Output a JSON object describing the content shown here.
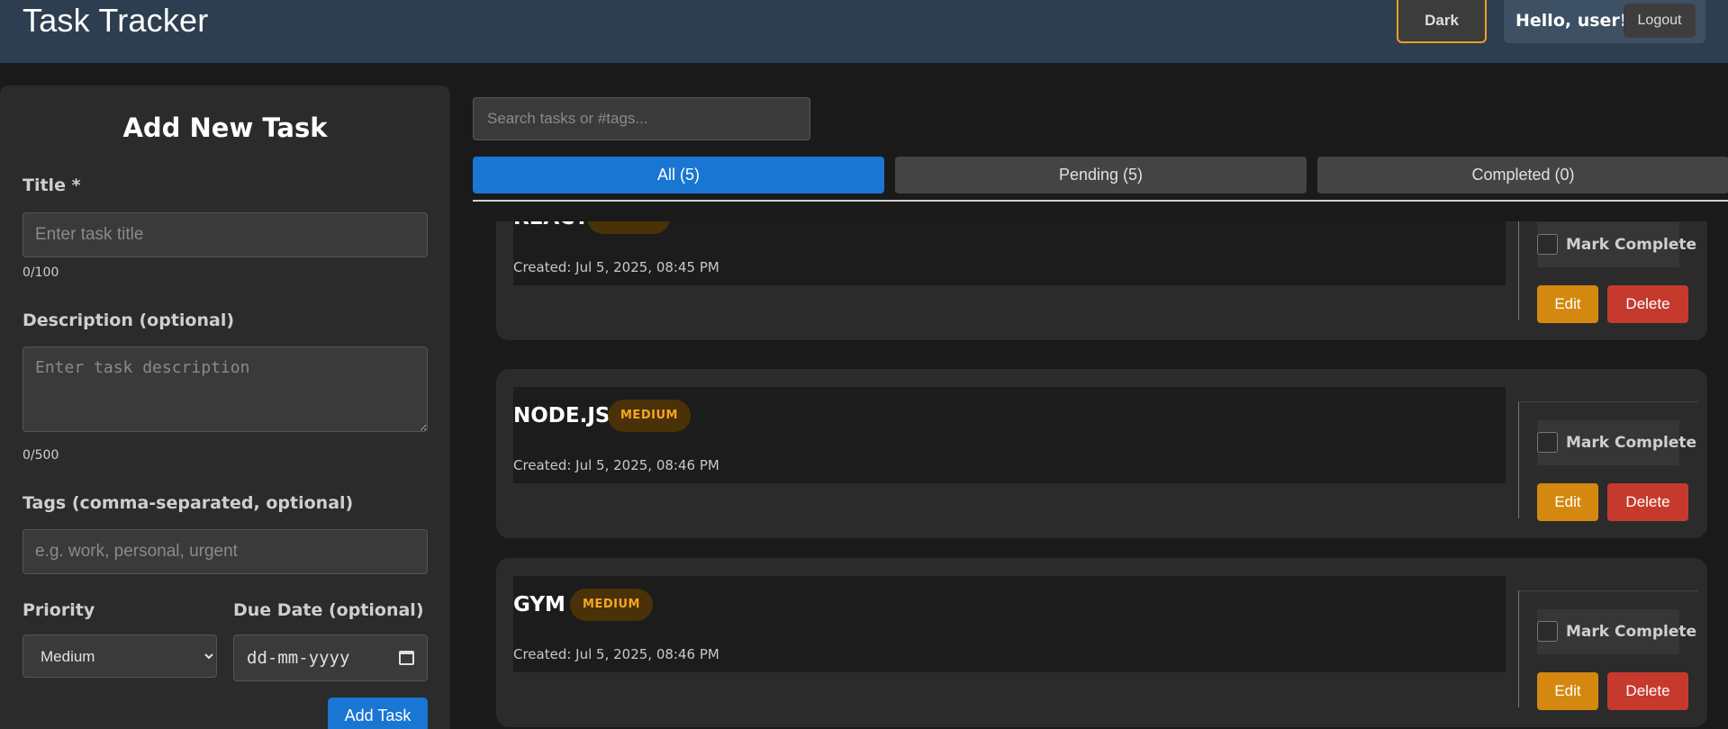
{
  "header": {
    "title": "Task Tracker",
    "theme_button": "Dark",
    "greeting": "Hello, user!",
    "logout": "Logout"
  },
  "form": {
    "heading": "Add New Task",
    "title_label": "Title *",
    "title_placeholder": "Enter task title",
    "title_value": "",
    "title_counter": "0/100",
    "description_label": "Description (optional)",
    "description_placeholder": "Enter task description",
    "description_counter": "0/500",
    "tags_label": "Tags (comma-separated, optional)",
    "tags_placeholder": "e.g. work, personal, urgent",
    "priority_label": "Priority",
    "priority_selected": "Medium",
    "due_label": "Due Date (optional)",
    "due_placeholder": "dd-mm-yyyy",
    "submit": "Add Task"
  },
  "search": {
    "placeholder": "Search tasks or #tags..."
  },
  "tabs": [
    {
      "label": "All (5)",
      "active": true
    },
    {
      "label": "Pending (5)",
      "active": false
    },
    {
      "label": "Completed (0)",
      "active": false
    }
  ],
  "tasks": [
    {
      "title": "REACT",
      "priority": "MEDIUM",
      "created": "Created: Jul 5, 2025, 08:45 PM",
      "mark_label": "Mark Complete",
      "edit": "Edit",
      "delete": "Delete"
    },
    {
      "title": "NODE.JS",
      "priority": "MEDIUM",
      "created": "Created: Jul 5, 2025, 08:46 PM",
      "mark_label": "Mark Complete",
      "edit": "Edit",
      "delete": "Delete"
    },
    {
      "title": "GYM",
      "priority": "MEDIUM",
      "created": "Created: Jul 5, 2025, 08:46 PM",
      "mark_label": "Mark Complete",
      "edit": "Edit",
      "delete": "Delete"
    }
  ],
  "colors": {
    "accent": "#1976d2",
    "header_bg": "#2d3e50",
    "medium_badge": "#f6a623",
    "edit": "#d4880f",
    "delete": "#c53a2c"
  }
}
